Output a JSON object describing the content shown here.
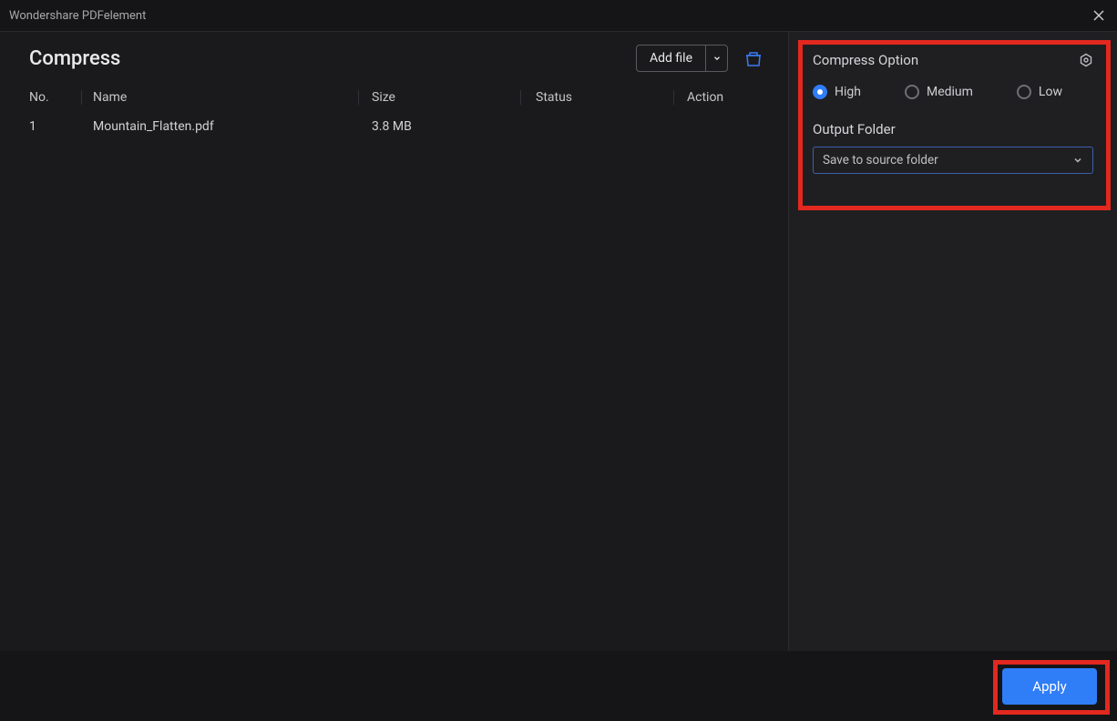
{
  "titlebar": {
    "app": "Wondershare PDFelement"
  },
  "main": {
    "title": "Compress",
    "add_file": "Add file",
    "columns": {
      "no": "No.",
      "name": "Name",
      "size": "Size",
      "status": "Status",
      "action": "Action"
    },
    "rows": [
      {
        "no": "1",
        "name": "Mountain_Flatten.pdf",
        "size": "3.8 MB",
        "status": "",
        "action": ""
      }
    ]
  },
  "options": {
    "title": "Compress Option",
    "levels": {
      "high": "High",
      "medium": "Medium",
      "low": "Low"
    },
    "selected": "high",
    "output_label": "Output Folder",
    "output_value": "Save to source folder"
  },
  "footer": {
    "apply": "Apply"
  }
}
